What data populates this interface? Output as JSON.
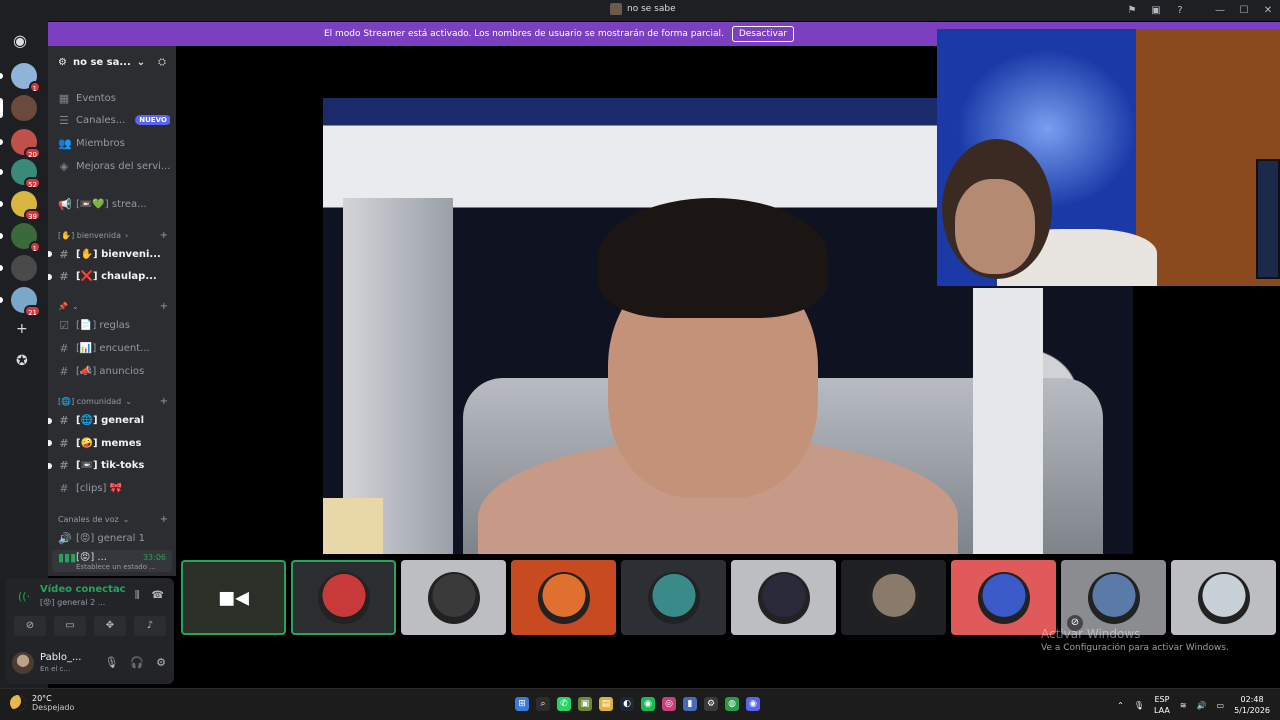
{
  "window": {
    "title": "no se sabe",
    "controls": [
      "flag-icon",
      "monitor-icon",
      "help-icon",
      "minimize",
      "maximize",
      "close"
    ]
  },
  "banner": {
    "text": "El modo Streamer está activado. Los nombres de usuario se mostrarán de forma parcial.",
    "button": "Desactivar"
  },
  "servers": [
    {
      "badge": "1",
      "color": "#8fb3d9"
    },
    {
      "badge": "",
      "color": "#6a4a3a"
    },
    {
      "badge": "20",
      "color": "#c0504a"
    },
    {
      "badge": "52",
      "color": "#3a8a7a"
    },
    {
      "badge": "39",
      "color": "#d9b640"
    },
    {
      "badge": "1",
      "color": "#3a6a3a"
    },
    {
      "badge": "",
      "color": "#4a4a4a"
    },
    {
      "badge": "21",
      "color": "#7aa8c8"
    }
  ],
  "sidebar": {
    "guild_name": "no se sa...",
    "top_items": [
      {
        "label": "Eventos"
      },
      {
        "label": "Canales...",
        "badge": "NUEVO"
      },
      {
        "label": "Miembros"
      },
      {
        "label": "Mejoras del servi..."
      }
    ],
    "announcement": "[📼💚] strea...",
    "categories": {
      "bienvenida": "[✋] bienvenida",
      "pinned": "📌",
      "comunidad": "[🌐] comunidad",
      "voz": "Canales de voz"
    },
    "channels_bienvenida": [
      "[✋] bienveni...",
      "[❌] chaulap..."
    ],
    "channels_pinned": [
      "[📄] reglas",
      "[📊] encuent...",
      "[📣] anuncios"
    ],
    "channels_comunidad": [
      "[🌐] general",
      "[🤪] memes",
      "[📼] tik-toks",
      "[clips] 🎀"
    ],
    "voice_channels": [
      {
        "label": "[😡] general 1"
      },
      {
        "label": "[😡] ...",
        "time": "33:06",
        "status": "Establece un estado ..."
      }
    ]
  },
  "user_panel": {
    "connection": "Vídeo conectac",
    "connection_sub": "[😡] general 2 ...",
    "username": "Pablo_...",
    "status": "En el c..."
  },
  "thumbnails": [
    {
      "type": "camera",
      "selected": true,
      "bg": "#2a2f28"
    },
    {
      "type": "avatar",
      "selected": true,
      "bg": "#2b2d31",
      "av": "#c83a3a"
    },
    {
      "type": "avatar",
      "selected": false,
      "bg": "#bdbec2",
      "av": "#3a3a3a"
    },
    {
      "type": "avatar",
      "selected": false,
      "bg": "#c84a20",
      "av": "#e07030"
    },
    {
      "type": "avatar",
      "selected": false,
      "bg": "#2e2f34",
      "av": "#3a8a8a"
    },
    {
      "type": "avatar",
      "selected": false,
      "bg": "#bdbec2",
      "av": "#2a2a3a"
    },
    {
      "type": "avatar",
      "selected": false,
      "bg": "#1f2023",
      "av": "#8a7a6a"
    },
    {
      "type": "avatar",
      "selected": false,
      "bg": "#e05a5a",
      "av": "#3a5ac8"
    },
    {
      "type": "avatar",
      "selected": false,
      "bg": "#8a8c90",
      "av": "#5a7aa8",
      "muted": true
    },
    {
      "type": "avatar",
      "selected": false,
      "bg": "#bdbec2",
      "av": "#c8d0d8"
    }
  ],
  "watermark": {
    "title": "Activar Windows",
    "subtitle": "Ve a Configuración para activar Windows."
  },
  "taskbar": {
    "temp": "20°C",
    "weather": "Despejado",
    "lang1": "ESP",
    "lang2": "LAA",
    "time": "02:48",
    "date": "5/1/2026"
  }
}
